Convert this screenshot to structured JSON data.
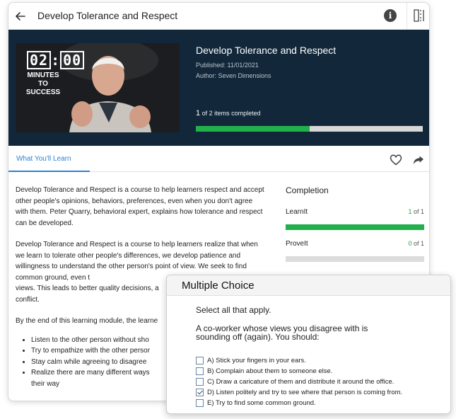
{
  "topbar": {
    "title": "Develop Tolerance and Respect"
  },
  "hero": {
    "title": "Develop Tolerance and Respect",
    "published": "Published: 11/01/2021",
    "author": "Author: Seven Dimensions",
    "progress_count": "1",
    "progress_text": " of 2 items completed",
    "progress_fraction": 0.5,
    "thumb": {
      "timer": [
        "02",
        "00"
      ],
      "caption": [
        "MINUTES",
        "TO",
        "SUCCESS"
      ]
    }
  },
  "tabs": {
    "active": "What You'll Learn"
  },
  "description": {
    "paragraphs": [
      "Develop Tolerance and Respect is a course to help learners respect and accept other people's opinions, behaviors, preferences, even when you don't agree with them. Peter Quarry, behavioral expert, explains how tolerance and respect can be developed.",
      "Develop Tolerance and Respect is a course to help learners realize that when we learn to tolerate other people's differences, we develop patience and willingness to understand the other person's point of view. We seek to find common ground, even t",
      "views. This leads to better quality decisions, a",
      "conflict.",
      "By the end of this learning module, the learne"
    ],
    "bullets": [
      "Listen to the other person without sho",
      "Try to empathize with the other persor",
      "Stay calm while agreeing to disagree",
      "Realize there are many different ways",
      "their way"
    ]
  },
  "completion": {
    "title": "Completion",
    "rows": [
      {
        "label": "LearnIt",
        "done": "1",
        "of": " of 1",
        "fraction": 1.0
      },
      {
        "label": "ProveIt",
        "done": "0",
        "of": " of 1",
        "fraction": 0.0
      }
    ]
  },
  "dialog": {
    "title": "Multiple Choice",
    "instruction": "Select all that apply.",
    "question_line1": "A co-worker whose views you disagree with is",
    "question_line2": "sounding off (again). You should:",
    "options": [
      {
        "text": "A) Stick your fingers in your ears.",
        "checked": false
      },
      {
        "text": "B) Complain about them to someone else.",
        "checked": false
      },
      {
        "text": "C) Draw a caricature of them and distribute it around the office.",
        "checked": false
      },
      {
        "text": "D) Listen politely and try to see where that person is coming from.",
        "checked": true
      },
      {
        "text": "E) Try to find some common ground.",
        "checked": false
      }
    ]
  },
  "colors": {
    "hero_bg": "#12283a",
    "accent_blue": "#2f7fd1",
    "progress_green": "#22b04c"
  },
  "icons": [
    "back-arrow-icon",
    "info-icon",
    "split-view-icon",
    "heart-icon",
    "share-icon",
    "checkbox-icon"
  ]
}
